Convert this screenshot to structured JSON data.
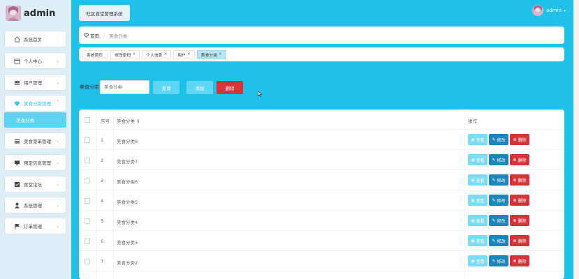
{
  "brand": {
    "title": "admin"
  },
  "header": {
    "system_title": "社区食堂管理系统",
    "username": "admin",
    "user_chevron": "▾"
  },
  "sidebar": {
    "items": [
      {
        "label": "系统首页",
        "icon": "home-icon"
      },
      {
        "label": "个人中心",
        "icon": "calendar-icon"
      },
      {
        "label": "用户管理",
        "icon": "list-icon"
      },
      {
        "label": "美食分类管理",
        "icon": "heart-icon",
        "active": true
      },
      {
        "label": "美食菜单管理",
        "icon": "list-icon"
      },
      {
        "label": "预定信息管理",
        "icon": "monitor-icon"
      },
      {
        "label": "食堂论坛",
        "icon": "checkbox-icon"
      },
      {
        "label": "系统管理",
        "icon": "user-icon"
      },
      {
        "label": "订单管理",
        "icon": "flag-icon"
      }
    ],
    "sub_item": {
      "label": "美食分类"
    }
  },
  "breadcrumb": {
    "home": "首页",
    "separator": "/",
    "current": "美食分类"
  },
  "tags": [
    {
      "label": "系统首页",
      "close": ""
    },
    {
      "label": "修改密码",
      "close": "×"
    },
    {
      "label": "个人信息",
      "close": "×"
    },
    {
      "label": "用户",
      "close": "×"
    },
    {
      "label": "美食分类",
      "close": "×",
      "active": true
    }
  ],
  "search": {
    "label": "美食分类",
    "placeholder": "美食分类",
    "search_button": "查询",
    "add_button": "添加",
    "delete_button": "删除"
  },
  "table": {
    "headers": {
      "index": "序号",
      "category": "美食分类",
      "sort_icon": "⇕",
      "actions": "操作"
    },
    "rows": [
      {
        "index": "1",
        "category": "美食分类8"
      },
      {
        "index": "2",
        "category": "美食分类7"
      },
      {
        "index": "3",
        "category": "美食分类6"
      },
      {
        "index": "4",
        "category": "美食分类5"
      },
      {
        "index": "5",
        "category": "美食分类4"
      },
      {
        "index": "6",
        "category": "美食分类3"
      },
      {
        "index": "7",
        "category": "美食分类2"
      }
    ],
    "row_actions": {
      "view": "查看",
      "edit": "修改",
      "delete": "删除"
    }
  },
  "colors": {
    "background": "#1fc0ea",
    "sidebar": "#dfeef6",
    "accent": "#5fd6f5",
    "danger": "#d6343b",
    "edit": "#1d86b9"
  }
}
